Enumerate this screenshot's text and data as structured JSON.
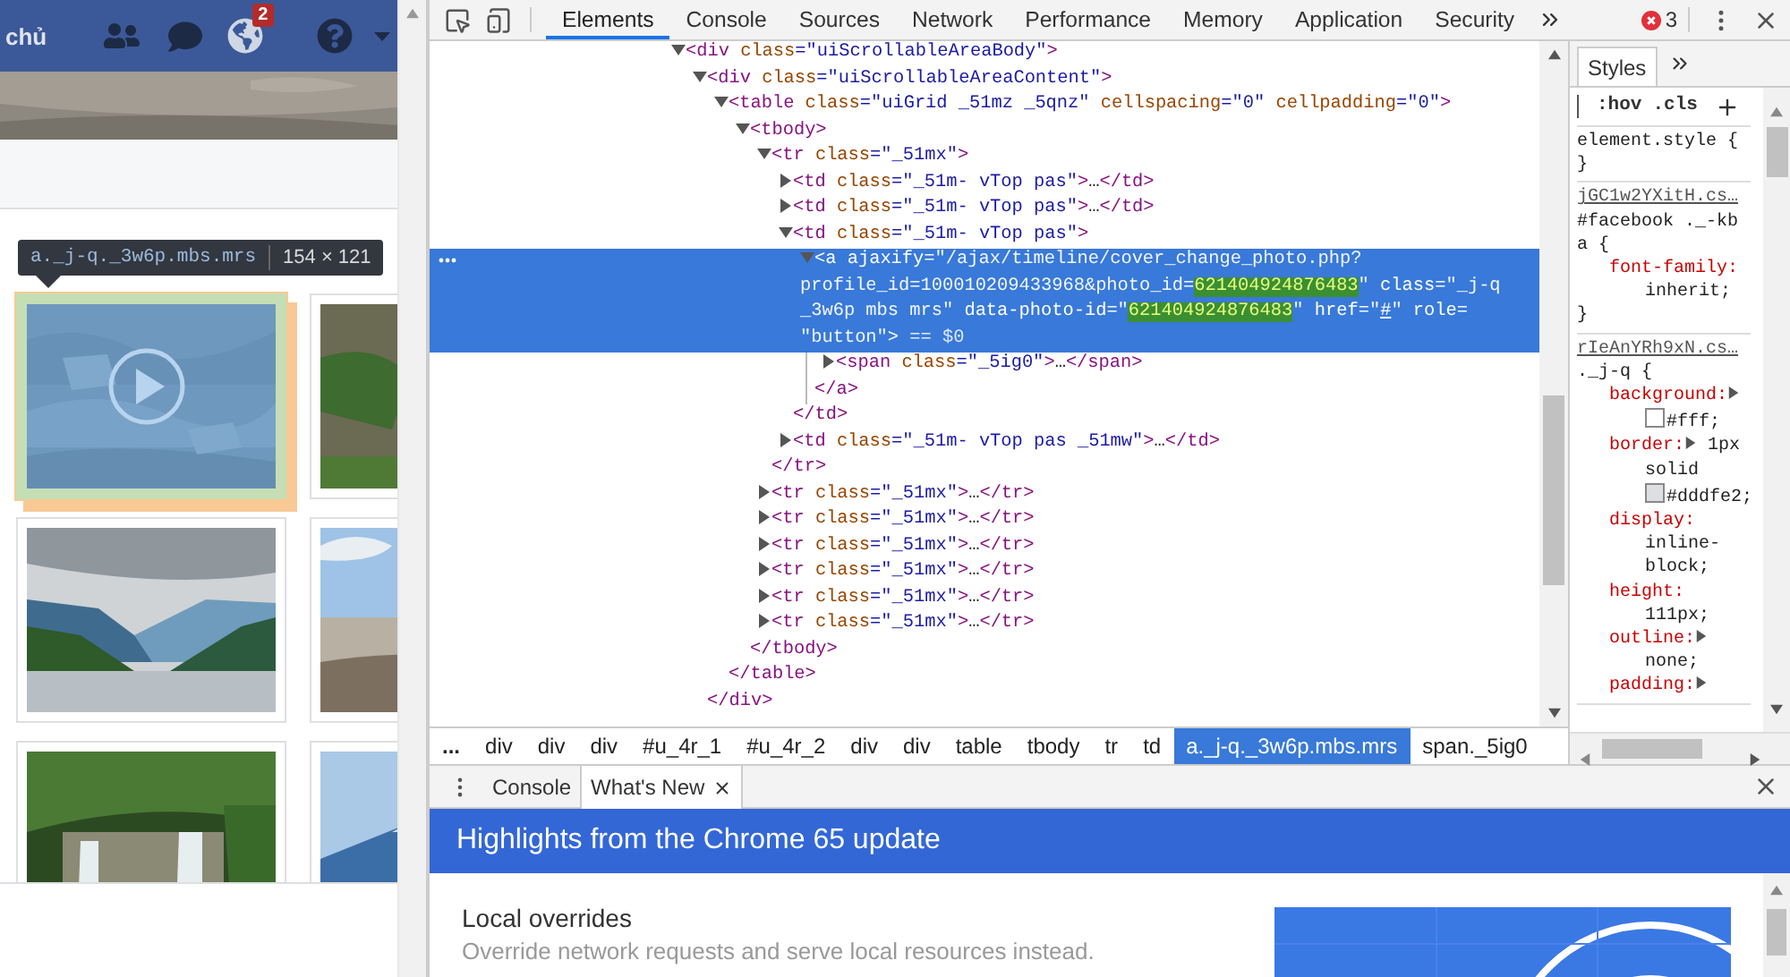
{
  "page": {
    "nav_label": "chủ",
    "notification_count": "2",
    "tooltip": {
      "selector": "a._j-q._3w6p.mbs.mrs",
      "size": "154 × 121"
    },
    "photos": [
      {
        "kind": "video",
        "highlighted": true
      },
      {
        "kind": "picture",
        "highlighted": false
      },
      {
        "kind": "picture",
        "highlighted": false
      },
      {
        "kind": "picture",
        "highlighted": false
      },
      {
        "kind": "picture",
        "highlighted": false
      },
      {
        "kind": "picture",
        "highlighted": false
      }
    ]
  },
  "devtools": {
    "tabs": [
      {
        "label": "Elements",
        "selected": true
      },
      {
        "label": "Console",
        "selected": false
      },
      {
        "label": "Sources",
        "selected": false
      },
      {
        "label": "Network",
        "selected": false
      },
      {
        "label": "Performance",
        "selected": false
      },
      {
        "label": "Memory",
        "selected": false
      },
      {
        "label": "Application",
        "selected": false
      },
      {
        "label": "Security",
        "selected": false
      }
    ],
    "error_count": "3",
    "dom_tree": [
      {
        "selected": false,
        "expanded": true,
        "lines": [
          [
            {
              "kind": "tag",
              "text": "<div"
            },
            {
              "kind": "attr",
              "text": " class"
            },
            {
              "kind": "value",
              "text": "=\"uiScrollableAreaBody\""
            },
            {
              "kind": "tag",
              "text": ">"
            }
          ]
        ],
        "children": [
          {
            "selected": false,
            "expanded": true,
            "lines": [
              [
                {
                  "kind": "tag",
                  "text": "<div"
                },
                {
                  "kind": "attr",
                  "text": " class"
                },
                {
                  "kind": "value",
                  "text": "=\"uiScrollableAreaContent\""
                },
                {
                  "kind": "tag",
                  "text": ">"
                }
              ]
            ],
            "close": [
              {
                "kind": "tag",
                "text": "</div>"
              }
            ],
            "children": [
              {
                "selected": false,
                "expanded": true,
                "lines": [
                  [
                    {
                      "kind": "tag",
                      "text": "<table"
                    },
                    {
                      "kind": "attr",
                      "text": " class"
                    },
                    {
                      "kind": "value",
                      "text": "=\"uiGrid _51mz _5qnz\""
                    },
                    {
                      "kind": "attr",
                      "text": " cellspacing"
                    },
                    {
                      "kind": "value",
                      "text": "=\"0\""
                    },
                    {
                      "kind": "attr",
                      "text": " cellpadding"
                    },
                    {
                      "kind": "value",
                      "text": "=\"0\""
                    },
                    {
                      "kind": "tag",
                      "text": ">"
                    }
                  ]
                ],
                "close": [
                  {
                    "kind": "tag",
                    "text": "</table>"
                  }
                ],
                "children": [
                  {
                    "selected": false,
                    "expanded": true,
                    "lines": [
                      [
                        {
                          "kind": "tag",
                          "text": "<tbody>"
                        }
                      ]
                    ],
                    "close": [
                      {
                        "kind": "tag",
                        "text": "</tbody>"
                      }
                    ],
                    "children": [
                      {
                        "selected": false,
                        "expanded": true,
                        "lines": [
                          [
                            {
                              "kind": "tag",
                              "text": "<tr"
                            },
                            {
                              "kind": "attr",
                              "text": " class"
                            },
                            {
                              "kind": "value",
                              "text": "=\"_51mx\""
                            },
                            {
                              "kind": "tag",
                              "text": ">"
                            }
                          ]
                        ],
                        "close": [
                          {
                            "kind": "tag",
                            "text": "</tr>"
                          }
                        ],
                        "children": [
                          {
                            "selected": false,
                            "expanded": false,
                            "lines": [
                              [
                                {
                                  "kind": "tag",
                                  "text": "<td"
                                },
                                {
                                  "kind": "attr",
                                  "text": " class"
                                },
                                {
                                  "kind": "value",
                                  "text": "=\"_51m- vTop pas\""
                                },
                                {
                                  "kind": "tag",
                                  "text": ">"
                                },
                                {
                                  "kind": "plain",
                                  "text": "…"
                                },
                                {
                                  "kind": "tag",
                                  "text": "</td>"
                                }
                              ]
                            ]
                          },
                          {
                            "selected": false,
                            "expanded": false,
                            "lines": [
                              [
                                {
                                  "kind": "tag",
                                  "text": "<td"
                                },
                                {
                                  "kind": "attr",
                                  "text": " class"
                                },
                                {
                                  "kind": "value",
                                  "text": "=\"_51m- vTop pas\""
                                },
                                {
                                  "kind": "tag",
                                  "text": ">"
                                },
                                {
                                  "kind": "plain",
                                  "text": "…"
                                },
                                {
                                  "kind": "tag",
                                  "text": "</td>"
                                }
                              ]
                            ]
                          },
                          {
                            "selected": false,
                            "expanded": true,
                            "lines": [
                              [
                                {
                                  "kind": "tag",
                                  "text": "<td"
                                },
                                {
                                  "kind": "attr",
                                  "text": " class"
                                },
                                {
                                  "kind": "value",
                                  "text": "=\"_51m- vTop pas\""
                                },
                                {
                                  "kind": "tag",
                                  "text": ">"
                                }
                              ]
                            ],
                            "close": [
                              {
                                "kind": "tag",
                                "text": "</td>"
                              }
                            ],
                            "children": [
                              {
                                "selected": true,
                                "expanded": true,
                                "lines": [
                                  [
                                    {
                                      "kind": "tag",
                                      "text": "<a"
                                    },
                                    {
                                      "kind": "attr",
                                      "text": " ajaxify"
                                    },
                                    {
                                      "kind": "value",
                                      "text": "=\"/ajax/timeline/cover_change_photo.php?"
                                    }
                                  ],
                                  [
                                    {
                                      "kind": "value",
                                      "text": "profile_id=100010209433968&photo_id="
                                    },
                                    {
                                      "kind": "highlight",
                                      "text": "621404924876483"
                                    },
                                    {
                                      "kind": "value",
                                      "text": "\""
                                    },
                                    {
                                      "kind": "attr",
                                      "text": " class"
                                    },
                                    {
                                      "kind": "value",
                                      "text": "=\"_j-q"
                                    }
                                  ],
                                  [
                                    {
                                      "kind": "value",
                                      "text": "_3w6p mbs mrs\""
                                    },
                                    {
                                      "kind": "attr",
                                      "text": " data-photo-id"
                                    },
                                    {
                                      "kind": "value",
                                      "text": "=\""
                                    },
                                    {
                                      "kind": "highlight",
                                      "text": "621404924876483"
                                    },
                                    {
                                      "kind": "value",
                                      "text": "\""
                                    },
                                    {
                                      "kind": "attr",
                                      "text": " href"
                                    },
                                    {
                                      "kind": "value",
                                      "text": "=\""
                                    },
                                    {
                                      "kind": "link",
                                      "text": "#"
                                    },
                                    {
                                      "kind": "value",
                                      "text": "\""
                                    },
                                    {
                                      "kind": "attr",
                                      "text": " role"
                                    },
                                    {
                                      "kind": "value",
                                      "text": "="
                                    }
                                  ],
                                  [
                                    {
                                      "kind": "value",
                                      "text": "\"button\""
                                    },
                                    {
                                      "kind": "tag",
                                      "text": ">"
                                    },
                                    {
                                      "kind": "dim",
                                      "text": " == $0"
                                    }
                                  ]
                                ],
                                "close": [
                                  {
                                    "kind": "tag",
                                    "text": "</a>"
                                  }
                                ],
                                "children": [
                                  {
                                    "selected": false,
                                    "expanded": false,
                                    "lines": [
                                      [
                                        {
                                          "kind": "tag",
                                          "text": "<span"
                                        },
                                        {
                                          "kind": "attr",
                                          "text": " class"
                                        },
                                        {
                                          "kind": "value",
                                          "text": "=\"_5ig0\""
                                        },
                                        {
                                          "kind": "tag",
                                          "text": ">"
                                        },
                                        {
                                          "kind": "plain",
                                          "text": "…"
                                        },
                                        {
                                          "kind": "tag",
                                          "text": "</span>"
                                        }
                                      ]
                                    ]
                                  }
                                ]
                              }
                            ]
                          },
                          {
                            "selected": false,
                            "expanded": false,
                            "lines": [
                              [
                                {
                                  "kind": "tag",
                                  "text": "<td"
                                },
                                {
                                  "kind": "attr",
                                  "text": " class"
                                },
                                {
                                  "kind": "value",
                                  "text": "=\"_51m- vTop pas _51mw\""
                                },
                                {
                                  "kind": "tag",
                                  "text": ">"
                                },
                                {
                                  "kind": "plain",
                                  "text": "…"
                                },
                                {
                                  "kind": "tag",
                                  "text": "</td>"
                                }
                              ]
                            ]
                          }
                        ]
                      },
                      {
                        "selected": false,
                        "expanded": false,
                        "lines": [
                          [
                            {
                              "kind": "tag",
                              "text": "<tr"
                            },
                            {
                              "kind": "attr",
                              "text": " class"
                            },
                            {
                              "kind": "value",
                              "text": "=\"_51mx\""
                            },
                            {
                              "kind": "tag",
                              "text": ">"
                            },
                            {
                              "kind": "plain",
                              "text": "…"
                            },
                            {
                              "kind": "tag",
                              "text": "</tr>"
                            }
                          ]
                        ]
                      },
                      {
                        "selected": false,
                        "expanded": false,
                        "lines": [
                          [
                            {
                              "kind": "tag",
                              "text": "<tr"
                            },
                            {
                              "kind": "attr",
                              "text": " class"
                            },
                            {
                              "kind": "value",
                              "text": "=\"_51mx\""
                            },
                            {
                              "kind": "tag",
                              "text": ">"
                            },
                            {
                              "kind": "plain",
                              "text": "…"
                            },
                            {
                              "kind": "tag",
                              "text": "</tr>"
                            }
                          ]
                        ]
                      },
                      {
                        "selected": false,
                        "expanded": false,
                        "lines": [
                          [
                            {
                              "kind": "tag",
                              "text": "<tr"
                            },
                            {
                              "kind": "attr",
                              "text": " class"
                            },
                            {
                              "kind": "value",
                              "text": "=\"_51mx\""
                            },
                            {
                              "kind": "tag",
                              "text": ">"
                            },
                            {
                              "kind": "plain",
                              "text": "…"
                            },
                            {
                              "kind": "tag",
                              "text": "</tr>"
                            }
                          ]
                        ]
                      },
                      {
                        "selected": false,
                        "expanded": false,
                        "lines": [
                          [
                            {
                              "kind": "tag",
                              "text": "<tr"
                            },
                            {
                              "kind": "attr",
                              "text": " class"
                            },
                            {
                              "kind": "value",
                              "text": "=\"_51mx\""
                            },
                            {
                              "kind": "tag",
                              "text": ">"
                            },
                            {
                              "kind": "plain",
                              "text": "…"
                            },
                            {
                              "kind": "tag",
                              "text": "</tr>"
                            }
                          ]
                        ]
                      },
                      {
                        "selected": false,
                        "expanded": false,
                        "lines": [
                          [
                            {
                              "kind": "tag",
                              "text": "<tr"
                            },
                            {
                              "kind": "attr",
                              "text": " class"
                            },
                            {
                              "kind": "value",
                              "text": "=\"_51mx\""
                            },
                            {
                              "kind": "tag",
                              "text": ">"
                            },
                            {
                              "kind": "plain",
                              "text": "…"
                            },
                            {
                              "kind": "tag",
                              "text": "</tr>"
                            }
                          ]
                        ]
                      },
                      {
                        "selected": false,
                        "expanded": false,
                        "lines": [
                          [
                            {
                              "kind": "tag",
                              "text": "<tr"
                            },
                            {
                              "kind": "attr",
                              "text": " class"
                            },
                            {
                              "kind": "value",
                              "text": "=\"_51mx\""
                            },
                            {
                              "kind": "tag",
                              "text": ">"
                            },
                            {
                              "kind": "plain",
                              "text": "…"
                            },
                            {
                              "kind": "tag",
                              "text": "</tr>"
                            }
                          ]
                        ]
                      }
                    ]
                  }
                ]
              }
            ]
          }
        ]
      }
    ],
    "breadcrumbs": [
      {
        "label": "...",
        "selected": false
      },
      {
        "label": "div",
        "selected": false
      },
      {
        "label": "div",
        "selected": false
      },
      {
        "label": "div",
        "selected": false
      },
      {
        "label": "#u_4r_1",
        "selected": false
      },
      {
        "label": "#u_4r_2",
        "selected": false
      },
      {
        "label": "div",
        "selected": false
      },
      {
        "label": "div",
        "selected": false
      },
      {
        "label": "table",
        "selected": false
      },
      {
        "label": "tbody",
        "selected": false
      },
      {
        "label": "tr",
        "selected": false
      },
      {
        "label": "td",
        "selected": false
      },
      {
        "label": "a._j-q._3w6p.mbs.mrs",
        "selected": true
      },
      {
        "label": "span._5ig0",
        "selected": false
      }
    ],
    "styles": {
      "tabs": [
        {
          "label": "Styles",
          "selected": true
        }
      ],
      "hov": ":hov",
      "cls": ".cls",
      "rules": [
        {
          "selector": "element.style {",
          "close": "}"
        },
        {
          "source": "jGC1w2YXitH.cs…",
          "selector": "#facebook ._-kb a {",
          "close": "}",
          "declarations": [
            {
              "property": "font-family:",
              "expandable": false,
              "value": "inherit;"
            }
          ]
        },
        {
          "source": "rIeAnYRh9xN.cs…",
          "selector": "._j-q {",
          "declarations": [
            {
              "property": "background:",
              "expandable": true,
              "color_value": "#fff;"
            },
            {
              "property": "border:",
              "expandable": true,
              "value": "1px solid",
              "color_value": "#dddfe2;"
            },
            {
              "property": "display:",
              "expandable": false,
              "value": "inline-block;"
            },
            {
              "property": "height:",
              "expandable": false,
              "value": "111px;"
            },
            {
              "property": "outline:",
              "expandable": true,
              "value": "none;"
            },
            {
              "property": "padding:",
              "expandable": true
            }
          ]
        }
      ]
    },
    "drawer": {
      "tabs": [
        {
          "label": "Console",
          "selected": false,
          "closable": false
        },
        {
          "label": "What's New",
          "selected": true,
          "closable": true
        }
      ],
      "banner": "Highlights from the Chrome 65 update",
      "features": [
        {
          "title": "Local overrides",
          "description": "Override network requests and serve local resources instead."
        }
      ]
    }
  }
}
